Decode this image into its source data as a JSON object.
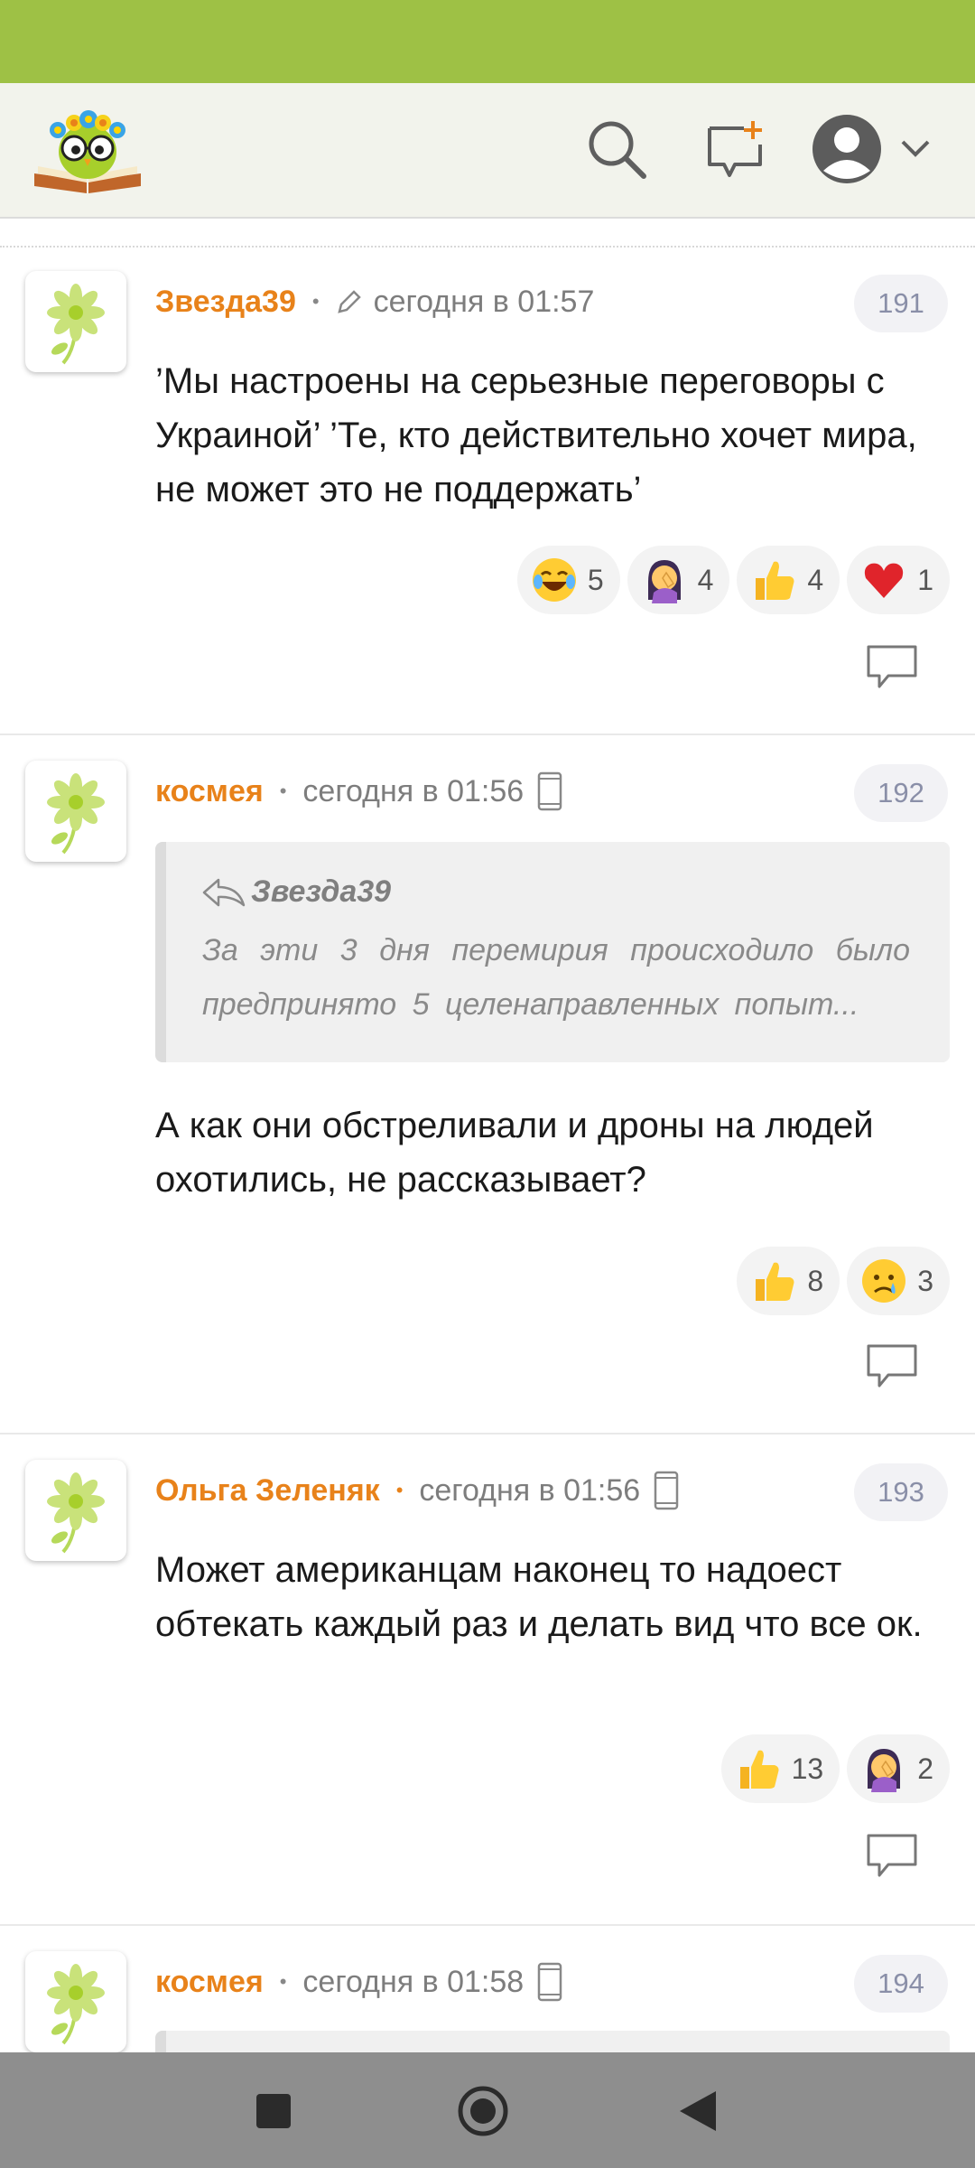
{
  "colors": {
    "status_bar": "#9ec145",
    "header_bg": "#f2f3ec",
    "author": "#e8821a",
    "nav_bar": "#8e8e8e"
  },
  "header": {
    "logo": "owl-with-flowers-on-book-logo",
    "icons": [
      "search-icon",
      "new-message-icon",
      "user-avatar-icon",
      "chevron-down-icon"
    ]
  },
  "comments": [
    {
      "author": "Звезда39",
      "time": "сегодня в 01:57",
      "edited": true,
      "number": "191",
      "text": "’Мы настроены на серьезные переговоры с Украиной’ ’Те, кто действительно хочет мира, не может это не поддержать’",
      "reactions": [
        {
          "emoji": "laughing-tears",
          "count": "5"
        },
        {
          "emoji": "facepalm",
          "count": "4"
        },
        {
          "emoji": "thumbs-up",
          "count": "4"
        },
        {
          "emoji": "red-heart",
          "count": "1"
        }
      ]
    },
    {
      "author": "космея",
      "time": "сегодня в 01:56",
      "mobile": true,
      "number": "192",
      "quote": {
        "author": "Звезда39",
        "text": "За эти 3 дня перемирия происходило было предпринято 5 целенаправленных попыт..."
      },
      "text": "А как они обстреливали и дроны на людей охотились, не рассказывает?",
      "reactions": [
        {
          "emoji": "thumbs-up",
          "count": "8"
        },
        {
          "emoji": "crying-face",
          "count": "3"
        }
      ]
    },
    {
      "author": "Ольга Зеленяк",
      "time": "сегодня в 01:56",
      "mobile": true,
      "number": "193",
      "text": "Может американцам наконец то надоест обтекать каждый раз и делать вид что все ок.",
      "reactions": [
        {
          "emoji": "thumbs-up",
          "count": "13"
        },
        {
          "emoji": "facepalm",
          "count": "2"
        }
      ]
    },
    {
      "author": "космея",
      "time": "сегодня в 01:58",
      "mobile": true,
      "number": "194"
    }
  ],
  "nav": [
    "recent-apps-button",
    "home-button",
    "back-button"
  ]
}
